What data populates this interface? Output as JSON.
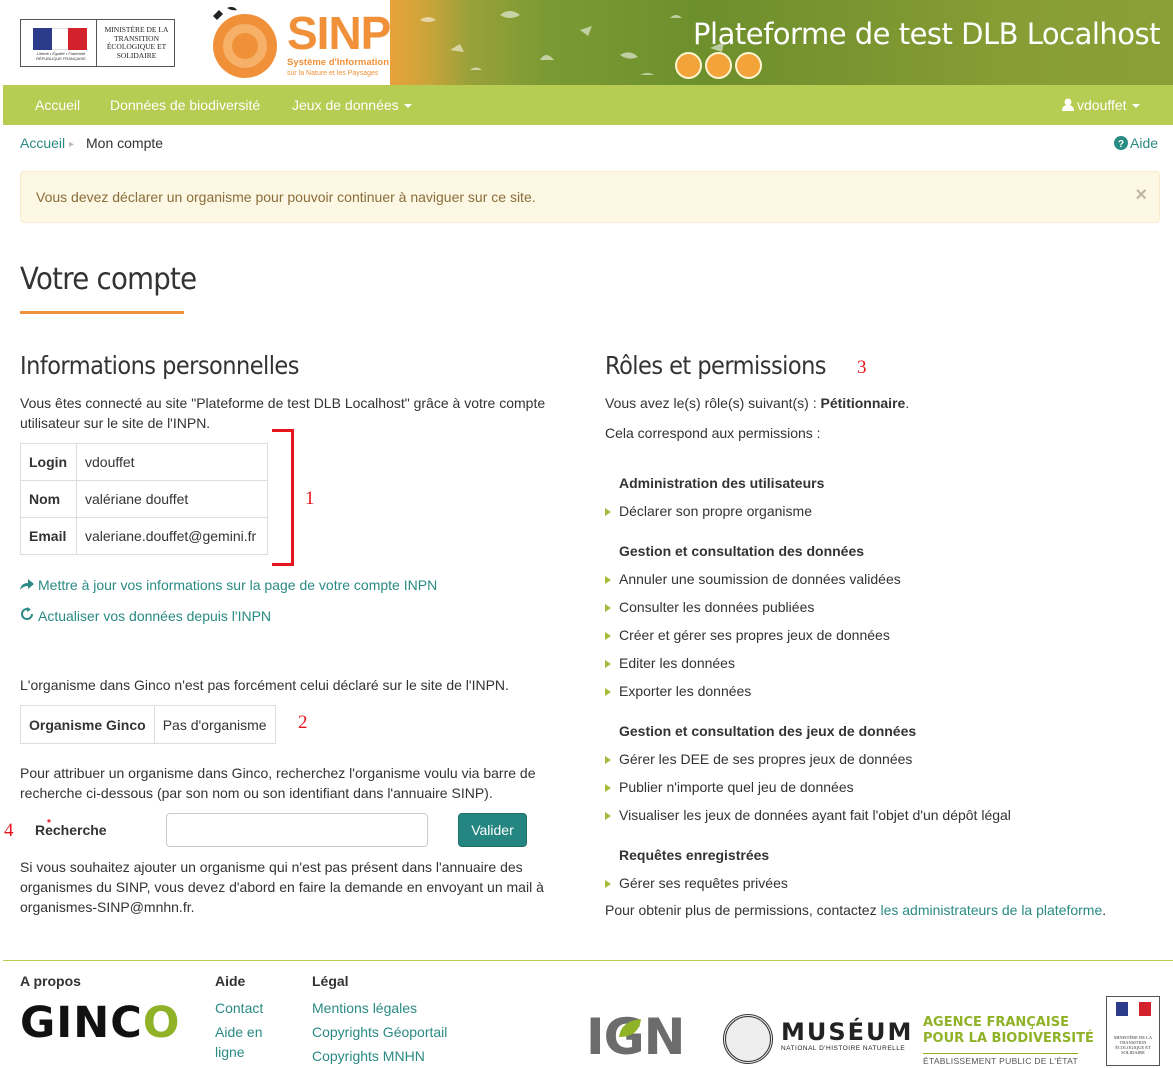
{
  "header": {
    "gov_logo_text": "MINISTÈRE DE LA TRANSITION ÉCOLOGIQUE ET SOLIDAIRE",
    "gov_motto": "Liberté • Égalité • Fraternité",
    "gov_republic": "RÉPUBLIQUE FRANÇAISE",
    "sinp_title": "SINP",
    "sinp_subtitle": "Système d'Information",
    "sinp_subtitle2": "sur la Nature et les Paysages",
    "platform_title": "Plateforme de test DLB Localhost"
  },
  "navbar": {
    "items": [
      {
        "label": "Accueil"
      },
      {
        "label": "Données de biodiversité"
      },
      {
        "label": "Jeux de données"
      }
    ],
    "user": "vdouffet"
  },
  "breadcrumb": {
    "home": "Accueil",
    "separator": "▸",
    "current": "Mon compte",
    "help": "Aide"
  },
  "alert": {
    "text": "Vous devez déclarer un organisme pour pouvoir continuer à naviguer sur ce site.",
    "close": "×"
  },
  "page_title": "Votre compte",
  "personal": {
    "heading": "Informations personnelles",
    "intro_line1": "Vous êtes connecté au site \"Plateforme de test DLB Localhost\" grâce à votre compte",
    "intro_line2": "utilisateur sur le site de l'INPN.",
    "rows": [
      {
        "key": "Login",
        "value": "vdouffet"
      },
      {
        "key": "Nom",
        "value": "valériane douffet"
      },
      {
        "key": "Email",
        "value": "valeriane.douffet@gemini.fr"
      }
    ],
    "update_link": "Mettre à jour vos informations sur la page de votre compte INPN",
    "refresh_link": "Actualiser vos données depuis l'INPN",
    "org_note": "L'organisme dans Ginco n'est pas forcément celui déclaré sur le site de l'INPN.",
    "org_key": "Organisme Ginco",
    "org_value": "Pas d'organisme",
    "assign_line1": "Pour attribuer un organisme dans Ginco, recherchez l'organisme voulu via barre de",
    "assign_line2": "recherche ci-dessous (par son nom ou son identifiant dans l'annuaire SINP).",
    "search_label": "Recherche",
    "search_required": "*",
    "search_value": "",
    "submit_label": "Valider",
    "add_line1": "Si vous souhaitez ajouter un organisme qui n'est pas présent dans l'annuaire des",
    "add_line2": "organismes du SINP, vous devez d'abord en faire la demande en envoyant un mail à",
    "add_line3": "organismes-SINP@mnhn.fr."
  },
  "roles": {
    "heading": "Rôles et permissions",
    "intro_prefix": "Vous avez le(s) rôle(s) suivant(s) : ",
    "role": "Pétitionnaire",
    "intro_suffix": ".",
    "corresponds": "Cela correspond aux permissions :",
    "groups": [
      {
        "title": "Administration des utilisateurs",
        "items": [
          "Déclarer son propre organisme"
        ]
      },
      {
        "title": "Gestion et consultation des données",
        "items": [
          "Annuler une soumission de données validées",
          "Consulter les données publiées",
          "Créer et gérer ses propres jeux de données",
          "Editer les données",
          "Exporter les données"
        ]
      },
      {
        "title": "Gestion et consultation des jeux de données",
        "items": [
          "Gérer les DEE de ses propres jeux de données",
          "Publier n'importe quel jeu de données",
          "Visualiser les jeux de données ayant fait l'objet d'un dépôt légal"
        ]
      },
      {
        "title": "Requêtes enregistrées",
        "items": [
          "Gérer ses requêtes privées"
        ]
      }
    ],
    "more_prefix": "Pour obtenir plus de permissions, contactez ",
    "more_link": "les administrateurs de la plateforme",
    "more_suffix": "."
  },
  "annotations": {
    "m1": "1",
    "m2": "2",
    "m3": "3",
    "m4": "4"
  },
  "footer": {
    "apropos": "A propos",
    "ginco_logo": "GINCO",
    "aide_heading": "Aide",
    "aide_links": [
      "Contact",
      "Aide en",
      "ligne"
    ],
    "legal_heading": "Légal",
    "legal_links": [
      "Mentions légales",
      "Copyrights Géoportail",
      "Copyrights MNHN"
    ],
    "ign": "IGN",
    "museum": "MUSÉUM",
    "museum_sub": "NATIONAL D'HISTOIRE NATURELLE",
    "afb_line1": "AGENCE FRANÇAISE",
    "afb_line2": "POUR LA BIODIVERSITÉ",
    "afb_line3": "ÉTABLISSEMENT PUBLIC DE L'ÉTAT",
    "ministry_small": "MINISTÈRE DE LA TRANSITION ÉCOLOGIQUE ET SOLIDAIRE"
  },
  "colors": {
    "navbar": "#b6cc52",
    "accent_orange": "#f0913a",
    "link_teal": "#2a8a84",
    "button_teal": "#258580",
    "annotation_red": "#e8141c"
  }
}
